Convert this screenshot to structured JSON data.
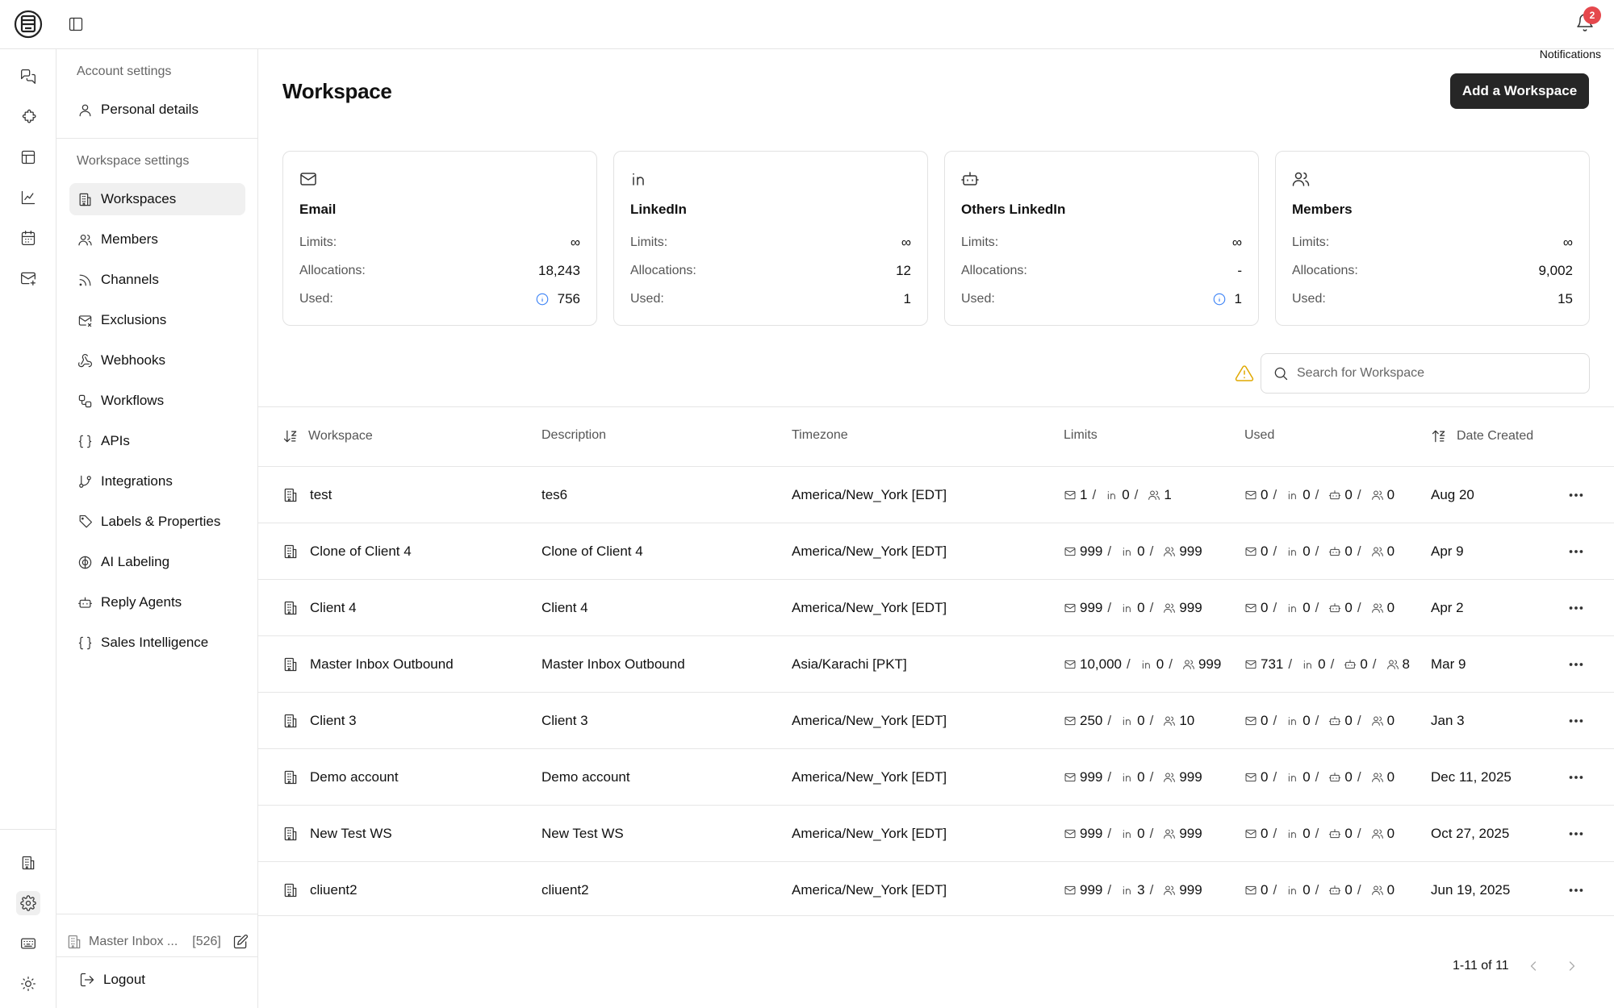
{
  "notifications": {
    "count": "2",
    "label": "Notifications"
  },
  "sidebar": {
    "account_title": "Account settings",
    "account_items": [
      {
        "label": "Personal details",
        "icon": "user-icon"
      }
    ],
    "workspace_title": "Workspace settings",
    "workspace_items": [
      {
        "label": "Workspaces",
        "icon": "building-icon",
        "active": true
      },
      {
        "label": "Members",
        "icon": "users-icon"
      },
      {
        "label": "Channels",
        "icon": "rss-icon"
      },
      {
        "label": "Exclusions",
        "icon": "mail-x-icon"
      },
      {
        "label": "Webhooks",
        "icon": "webhook-icon"
      },
      {
        "label": "Workflows",
        "icon": "workflow-icon"
      },
      {
        "label": "APIs",
        "icon": "braces-icon"
      },
      {
        "label": "Integrations",
        "icon": "git-branch-icon"
      },
      {
        "label": "Labels & Properties",
        "icon": "tag-icon"
      },
      {
        "label": "AI Labeling",
        "icon": "brain-icon"
      },
      {
        "label": "Reply Agents",
        "icon": "bot-icon"
      },
      {
        "label": "Sales Intelligence",
        "icon": "braces-icon"
      }
    ],
    "current_workspace": {
      "name": "Master Inbox ...",
      "count": "[526]"
    },
    "logout": "Logout"
  },
  "main": {
    "title": "Workspace",
    "add_button": "Add a Workspace",
    "search_placeholder": "Search for Workspace"
  },
  "cards": [
    {
      "title": "Email",
      "icon": "mail-icon",
      "limits_label": "Limits:",
      "limits": "∞",
      "alloc_label": "Allocations:",
      "allocations": "18,243",
      "used_label": "Used:",
      "used": "756",
      "info": true
    },
    {
      "title": "LinkedIn",
      "icon": "linkedin-icon",
      "limits_label": "Limits:",
      "limits": "∞",
      "alloc_label": "Allocations:",
      "allocations": "12",
      "used_label": "Used:",
      "used": "1",
      "info": false
    },
    {
      "title": "Others LinkedIn",
      "icon": "bot-icon",
      "limits_label": "Limits:",
      "limits": "∞",
      "alloc_label": "Allocations:",
      "allocations": "-",
      "used_label": "Used:",
      "used": "1",
      "info": true
    },
    {
      "title": "Members",
      "icon": "users-icon",
      "limits_label": "Limits:",
      "limits": "∞",
      "alloc_label": "Allocations:",
      "allocations": "9,002",
      "used_label": "Used:",
      "used": "15",
      "info": false
    }
  ],
  "table": {
    "columns": [
      "Workspace",
      "Description",
      "Timezone",
      "Limits",
      "Used",
      "Date Created"
    ],
    "rows": [
      {
        "name": "test",
        "desc": "tes6",
        "tz": "America/New_York [EDT]",
        "lim": [
          "1",
          "0",
          "1"
        ],
        "used": [
          "0",
          "0",
          "0",
          "0"
        ],
        "date": "Aug 20"
      },
      {
        "name": "Clone of Client 4",
        "desc": "Clone of Client 4",
        "tz": "America/New_York [EDT]",
        "lim": [
          "999",
          "0",
          "999"
        ],
        "used": [
          "0",
          "0",
          "0",
          "0"
        ],
        "date": "Apr 9"
      },
      {
        "name": "Client 4",
        "desc": "Client 4",
        "tz": "America/New_York [EDT]",
        "lim": [
          "999",
          "0",
          "999"
        ],
        "used": [
          "0",
          "0",
          "0",
          "0"
        ],
        "date": "Apr 2"
      },
      {
        "name": "Master Inbox Outbound",
        "desc": "Master Inbox Outbound",
        "tz": "Asia/Karachi [PKT]",
        "lim": [
          "10,000",
          "0",
          "999"
        ],
        "used": [
          "731",
          "0",
          "0",
          "8"
        ],
        "date": "Mar 9"
      },
      {
        "name": "Client 3",
        "desc": "Client 3",
        "tz": "America/New_York [EDT]",
        "lim": [
          "250",
          "0",
          "10"
        ],
        "used": [
          "0",
          "0",
          "0",
          "0"
        ],
        "date": "Jan 3"
      },
      {
        "name": "Demo account",
        "desc": "Demo account",
        "tz": "America/New_York [EDT]",
        "lim": [
          "999",
          "0",
          "999"
        ],
        "used": [
          "0",
          "0",
          "0",
          "0"
        ],
        "date": "Dec 11, 2025"
      },
      {
        "name": "New Test WS",
        "desc": "New Test WS",
        "tz": "America/New_York [EDT]",
        "lim": [
          "999",
          "0",
          "999"
        ],
        "used": [
          "0",
          "0",
          "0",
          "0"
        ],
        "date": "Oct 27, 2025"
      },
      {
        "name": "cliuent2",
        "desc": "cliuent2",
        "tz": "America/New_York [EDT]",
        "lim": [
          "999",
          "3",
          "999"
        ],
        "used": [
          "0",
          "0",
          "0",
          "0"
        ],
        "date": "Jun 19, 2025"
      }
    ]
  },
  "pagination": {
    "label": "1-11 of 11"
  }
}
